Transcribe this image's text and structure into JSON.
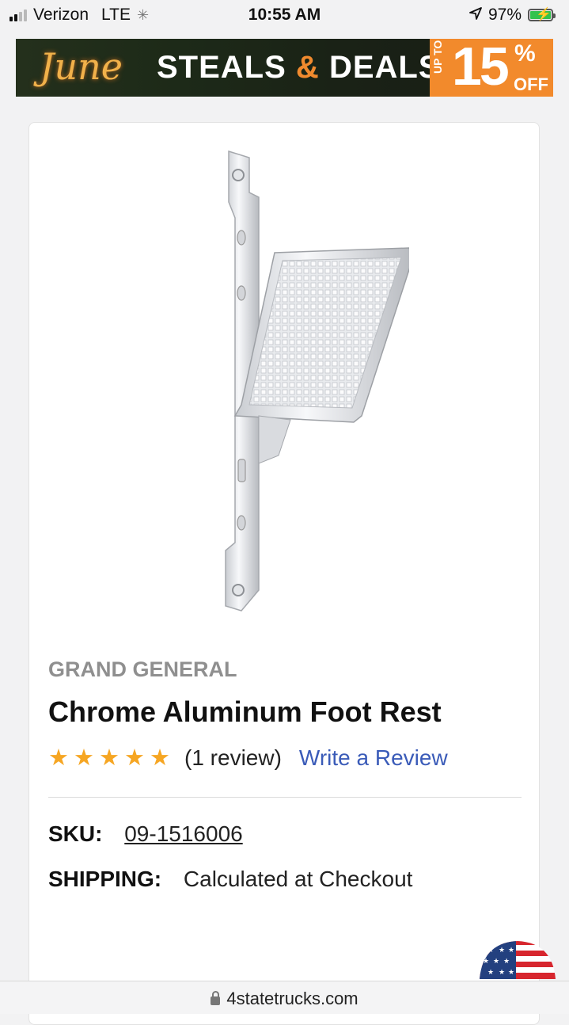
{
  "status_bar": {
    "carrier": "Verizon",
    "network": "LTE",
    "time": "10:55 AM",
    "battery": "97%",
    "battery_level": 0.97
  },
  "banner": {
    "script_text": "June",
    "headline_part1": "STEALS",
    "headline_amp": "&",
    "headline_part2": "DEALS",
    "up_to": "UP TO",
    "discount_number": "15",
    "discount_percent": "%",
    "discount_off": "OFF",
    "colors": {
      "accent": "#f28a2c",
      "dark": "#1d2a18"
    }
  },
  "product": {
    "brand": "GRAND GENERAL",
    "title": "Chrome Aluminum Foot Rest",
    "rating": 5,
    "rating_max": 5,
    "review_count": "(1 review)",
    "write_review": "Write a Review",
    "sku_label": "SKU:",
    "sku_value": "09-1516006",
    "shipping_label": "SHIPPING:",
    "shipping_value": "Calculated at Checkout"
  },
  "icons": {
    "signal": "signal-bars-icon",
    "location": "location-arrow-icon",
    "battery": "battery-charging-icon",
    "lock": "lock-icon",
    "flag": "us-flag-icon"
  },
  "url_bar": {
    "domain": "4statetrucks.com"
  }
}
